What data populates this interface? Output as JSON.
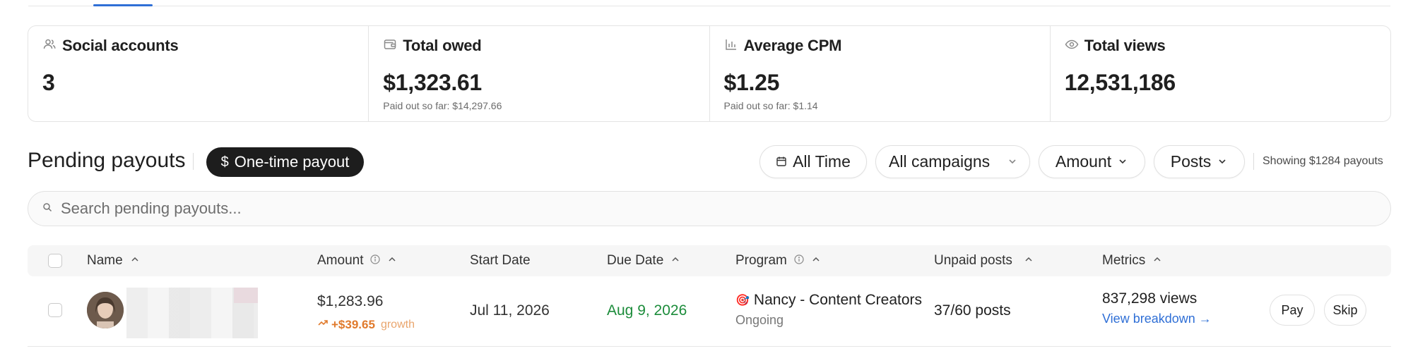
{
  "stats": [
    {
      "icon": "users-icon",
      "title": "Social accounts",
      "value": "3",
      "sub": ""
    },
    {
      "icon": "wallet-icon",
      "title": "Total owed",
      "value": "$1,323.61",
      "sub": "Paid out so far: $14,297.66"
    },
    {
      "icon": "bar-chart-icon",
      "title": "Average CPM",
      "value": "$1.25",
      "sub": "Paid out so far: $1.14"
    },
    {
      "icon": "eye-icon",
      "title": "Total views",
      "value": "12,531,186",
      "sub": ""
    }
  ],
  "toolbar": {
    "title": "Pending payouts",
    "onetime_label": "One-time payout",
    "onetime_symbol": "$",
    "filters": {
      "time": "All Time",
      "campaigns": "All campaigns",
      "amount": "Amount",
      "posts": "Posts"
    },
    "showing": "Showing $1284 payouts"
  },
  "search": {
    "placeholder": "Search pending payouts...",
    "value": ""
  },
  "table": {
    "columns": {
      "name": "Name",
      "amount": "Amount",
      "start_date": "Start Date",
      "due_date": "Due Date",
      "program": "Program",
      "unpaid_posts": "Unpaid posts",
      "metrics": "Metrics"
    },
    "rows": [
      {
        "amount": "$1,283.96",
        "growth_value": "+$39.65",
        "growth_label": "growth",
        "start_date": "Jul 11, 2026",
        "due_date": "Aug 9, 2026",
        "program_emoji": "🎯",
        "program_name": "Nancy - Content Creators",
        "program_status": "Ongoing",
        "unpaid_posts": "37/60 posts",
        "views": "837,298 views",
        "breakdown_link": "View breakdown →",
        "pay_label": "Pay",
        "skip_label": "Skip"
      }
    ]
  },
  "colors": {
    "accent_blue": "#2f6fd6",
    "due_green": "#1c8c3b",
    "growth_orange": "#e07a2c",
    "dark_button": "#1d1d1d"
  }
}
